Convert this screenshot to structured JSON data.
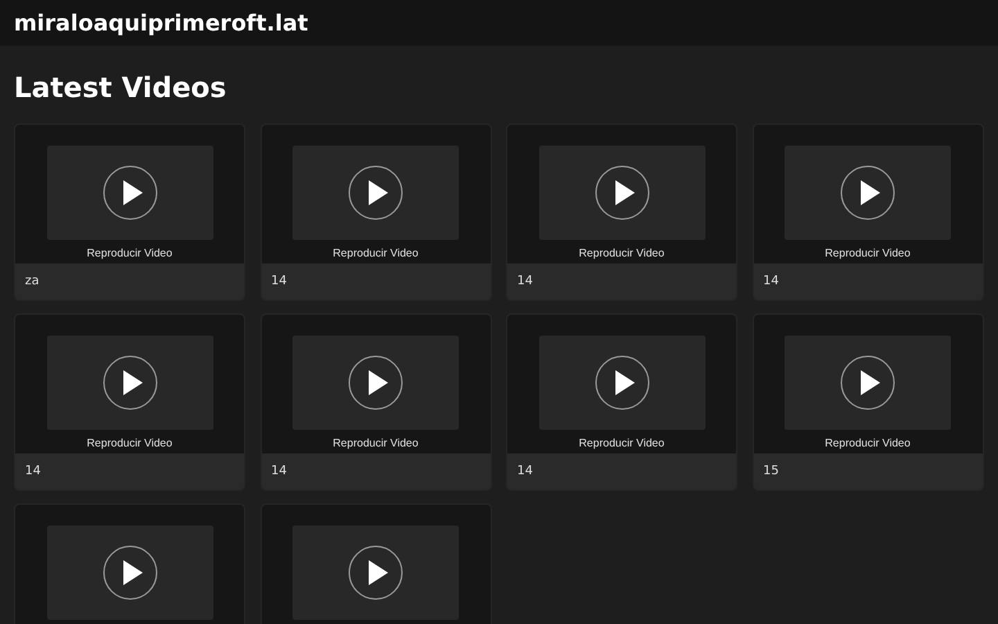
{
  "site_title": "miraloaquiprimeroft.lat",
  "heading": "Latest Videos",
  "videos": [
    {
      "kind": "video",
      "thumb_label": "Reproducir Video",
      "caption": "za"
    },
    {
      "kind": "video",
      "thumb_label": "Reproducir Video",
      "caption": "14"
    },
    {
      "kind": "video",
      "thumb_label": "Reproducir Video",
      "caption": "14"
    },
    {
      "kind": "video",
      "thumb_label": "Reproducir Video",
      "caption": "14"
    },
    {
      "kind": "video",
      "thumb_label": "Reproducir Video",
      "caption": "14"
    },
    {
      "kind": "video",
      "thumb_label": "Reproducir Video",
      "caption": "14"
    },
    {
      "kind": "video",
      "thumb_label": "Reproducir Video",
      "caption": "14"
    },
    {
      "kind": "video",
      "thumb_label": "Reproducir Video",
      "caption": "15"
    },
    {
      "kind": "video"
    },
    {
      "kind": "video"
    }
  ]
}
